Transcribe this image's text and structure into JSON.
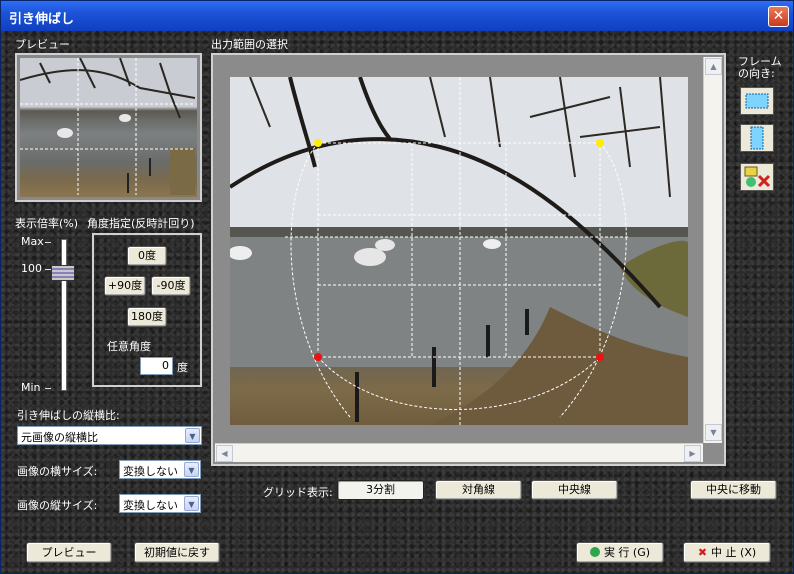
{
  "window": {
    "title": "引き伸ばし",
    "close": "✕"
  },
  "preview": {
    "label": "プレビュー"
  },
  "zoom": {
    "label": "表示倍率(%)",
    "max": "Max",
    "value": "100",
    "min": "Min"
  },
  "angle": {
    "label": "角度指定(反時計回り)",
    "btn_0": "0度",
    "btn_p90": "+90度",
    "btn_m90": "-90度",
    "btn_180": "180度",
    "custom_label": "任意角度",
    "custom_value": "0",
    "unit": "度"
  },
  "aspect": {
    "label": "引き伸ばしの縦横比:",
    "value": "元画像の縦横比"
  },
  "hsize": {
    "label": "画像の横サイズ:",
    "value": "変換しない"
  },
  "vsize": {
    "label": "画像の縦サイズ:",
    "value": "変換しない"
  },
  "output": {
    "label": "出力範囲の選択"
  },
  "frame": {
    "label_1": "フレーム",
    "label_2": "の向き:"
  },
  "grid": {
    "label": "グリッド表示:",
    "thirds": "3分割",
    "diagonal": "対角線",
    "center": "中央線"
  },
  "center_move": "中央に移動",
  "footer": {
    "preview": "プレビュー",
    "reset": "初期値に戻す",
    "run": "実 行 (G)",
    "cancel": "中 止 (X)"
  }
}
